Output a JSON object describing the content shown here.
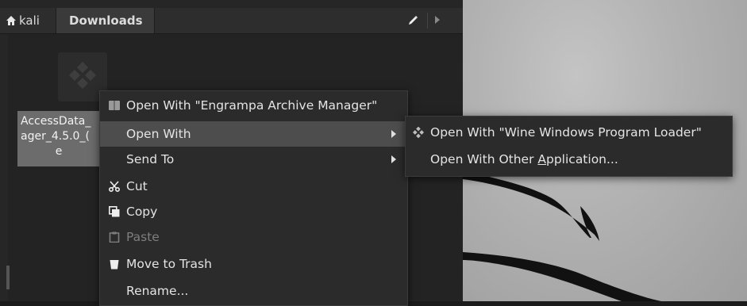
{
  "tabs": {
    "home_label": "kali",
    "current_label": "Downloads"
  },
  "file": {
    "name_line1": "AccessData_",
    "name_line2": "ager_4.5.0_(",
    "name_line3": "e"
  },
  "context_menu": {
    "items": [
      {
        "label": "Open With \"Engrampa Archive Manager\"",
        "icon": "archive-icon"
      },
      {
        "label": "Open With",
        "icon": "none",
        "submenu": true,
        "highlighted": true
      },
      {
        "label": "Send To",
        "icon": "none",
        "submenu": true
      },
      {
        "label": "Cut",
        "icon": "scissors-icon"
      },
      {
        "label": "Copy",
        "icon": "copy-icon"
      },
      {
        "label": "Paste",
        "icon": "paste-icon",
        "disabled": true
      },
      {
        "label": "Move to Trash",
        "icon": "trash-icon"
      },
      {
        "label": "Rename...",
        "icon": "none"
      }
    ]
  },
  "submenu": {
    "items": [
      {
        "label": "Open With \"Wine Windows Program Loader\"",
        "icon": "wine-icon"
      },
      {
        "label_before": "Open With Other ",
        "label_mnemonic": "A",
        "label_after": "pplication...",
        "icon": "none"
      }
    ]
  },
  "colors": {
    "menu_bg": "#2b2b2b",
    "highlight": "#4d4d4d",
    "selection": "#6c6c6c",
    "desktop": "#b3b3b3"
  }
}
